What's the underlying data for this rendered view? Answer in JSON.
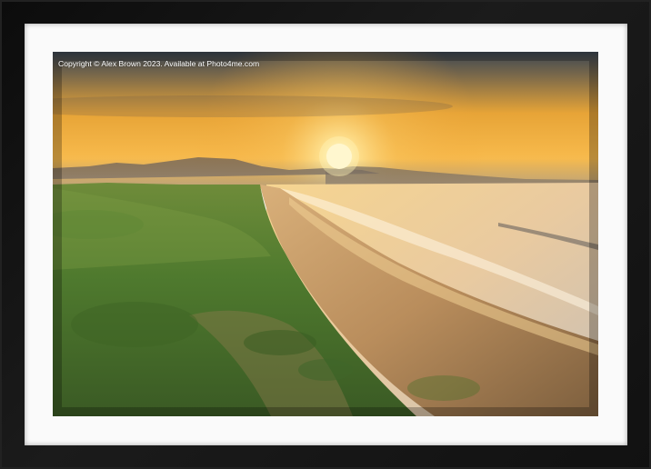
{
  "photo": {
    "copyright_text": "Copyright © Alex Brown 2023. Available at Photo4me.com",
    "subject": "sunset over beach with grass dunes"
  },
  "colors": {
    "frame": "#141414",
    "mat": "#fafafa",
    "sky_top": "#3f4a55",
    "sun": "#fff4c0",
    "grass": "#4f7a2e",
    "sand": "#b88a55",
    "sea": "#e7c79a"
  }
}
